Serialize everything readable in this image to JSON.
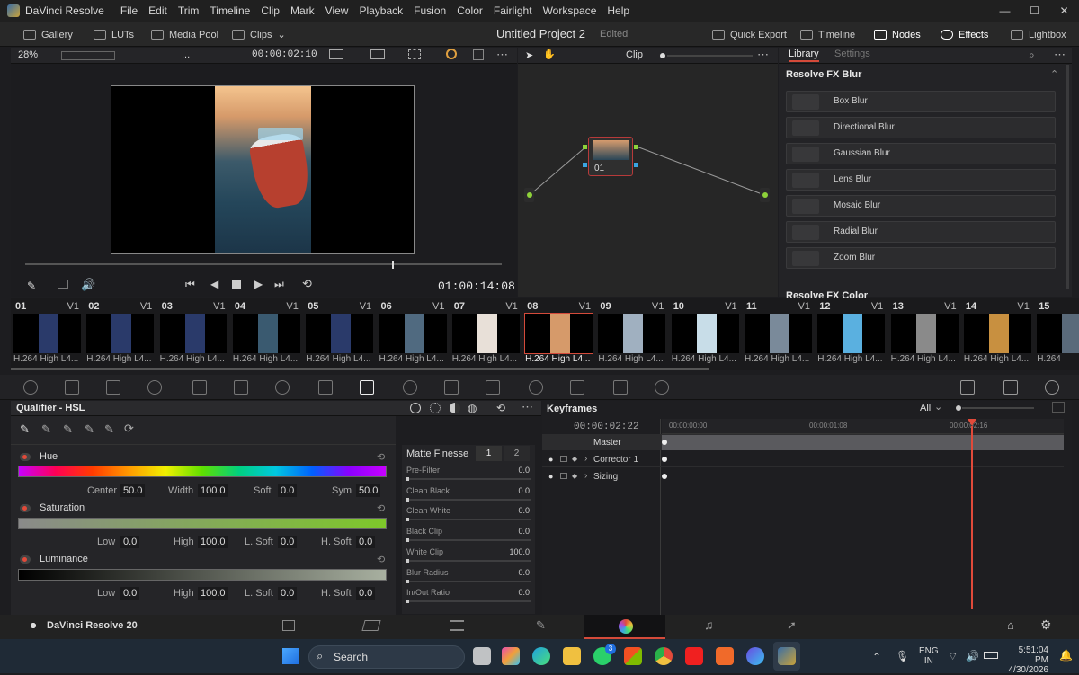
{
  "app": {
    "title": "DaVinci Resolve",
    "menu": [
      "File",
      "Edit",
      "Trim",
      "Timeline",
      "Clip",
      "Mark",
      "View",
      "Playback",
      "Fusion",
      "Color",
      "Fairlight",
      "Workspace",
      "Help"
    ],
    "window_controls": [
      "—",
      "☐",
      "✕"
    ]
  },
  "toolbar": {
    "gallery": "Gallery",
    "luts": "LUTs",
    "media_pool": "Media Pool",
    "clips": "Clips",
    "project_title": "Untitled Project 2",
    "project_state": "Edited",
    "quick_export": "Quick Export",
    "timeline": "Timeline",
    "nodes": "Nodes",
    "effects": "Effects",
    "lightbox": "Lightbox"
  },
  "viewer": {
    "zoom": "28%",
    "dots": "...",
    "timecode_top": "00:00:02:10",
    "timecode_main": "01:00:14:08",
    "scrub_position": 0.77
  },
  "nodes_panel": {
    "mode": "Clip",
    "node_label": "01"
  },
  "library": {
    "tab_library": "Library",
    "tab_settings": "Settings",
    "section_blur": "Resolve FX Blur",
    "section_color": "Resolve FX Color",
    "items": [
      "Box Blur",
      "Directional Blur",
      "Gaussian Blur",
      "Lens Blur",
      "Mosaic Blur",
      "Radial Blur",
      "Zoom Blur"
    ]
  },
  "clips": [
    {
      "num": "01",
      "track": "V1",
      "codec": "H.264 High L4..."
    },
    {
      "num": "02",
      "track": "V1",
      "codec": "H.264 High L4..."
    },
    {
      "num": "03",
      "track": "V1",
      "codec": "H.264 High L4..."
    },
    {
      "num": "04",
      "track": "V1",
      "codec": "H.264 High L4..."
    },
    {
      "num": "05",
      "track": "V1",
      "codec": "H.264 High L4..."
    },
    {
      "num": "06",
      "track": "V1",
      "codec": "H.264 High L4..."
    },
    {
      "num": "07",
      "track": "V1",
      "codec": "H.264 High L4..."
    },
    {
      "num": "08",
      "track": "V1",
      "codec": "H.264 High L4..."
    },
    {
      "num": "09",
      "track": "V1",
      "codec": "H.264 High L4..."
    },
    {
      "num": "10",
      "track": "V1",
      "codec": "H.264 High L4..."
    },
    {
      "num": "11",
      "track": "V1",
      "codec": "H.264 High L4..."
    },
    {
      "num": "12",
      "track": "V1",
      "codec": "H.264 High L4..."
    },
    {
      "num": "13",
      "track": "V1",
      "codec": "H.264 High L4..."
    },
    {
      "num": "14",
      "track": "V1",
      "codec": "H.264 High L4..."
    },
    {
      "num": "15",
      "track": "",
      "codec": "H.264"
    }
  ],
  "selected_clip": "08",
  "qualifier": {
    "title": "Qualifier - HSL",
    "hue": {
      "label": "Hue",
      "center_label": "Center",
      "center": "50.0",
      "width_label": "Width",
      "width": "100.0",
      "soft_label": "Soft",
      "soft": "0.0",
      "sym_label": "Sym",
      "sym": "50.0"
    },
    "saturation": {
      "label": "Saturation",
      "low_label": "Low",
      "low": "0.0",
      "high_label": "High",
      "high": "100.0",
      "lsoft_label": "L. Soft",
      "lsoft": "0.0",
      "hsoft_label": "H. Soft",
      "hsoft": "0.0"
    },
    "luminance": {
      "label": "Luminance",
      "low_label": "Low",
      "low": "0.0",
      "high_label": "High",
      "high": "100.0",
      "lsoft_label": "L. Soft",
      "lsoft": "0.0",
      "hsoft_label": "H. Soft",
      "hsoft": "0.0"
    }
  },
  "matte": {
    "title": "Matte Finesse",
    "tab1": "1",
    "tab2": "2",
    "rows": [
      {
        "label": "Pre-Filter",
        "value": "0.0"
      },
      {
        "label": "Clean Black",
        "value": "0.0"
      },
      {
        "label": "Clean White",
        "value": "0.0"
      },
      {
        "label": "Black Clip",
        "value": "0.0"
      },
      {
        "label": "White Clip",
        "value": "100.0"
      },
      {
        "label": "Blur Radius",
        "value": "0.0"
      },
      {
        "label": "In/Out Ratio",
        "value": "0.0"
      }
    ]
  },
  "keyframes": {
    "title": "Keyframes",
    "filter": "All",
    "timecode": "00:00:02:22",
    "ruler": [
      "00:00:00:00",
      "00:00:01:08",
      "00:00:02:16"
    ],
    "tracks": [
      "Master",
      "Corrector 1",
      "Sizing"
    ]
  },
  "footer": {
    "brand": "DaVinci Resolve 20"
  },
  "taskbar": {
    "search": "Search",
    "lang": "ENG",
    "region": "IN",
    "time": "5:51:04 PM",
    "date": "4/30/2026",
    "badge": "3"
  }
}
